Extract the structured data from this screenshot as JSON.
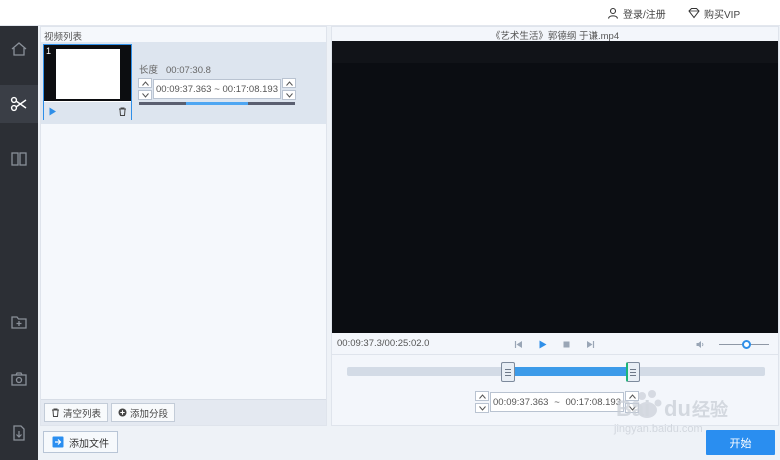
{
  "topbar": {
    "login_label": "登录/注册",
    "vip_label": "购买VIP",
    "login_icon": "user-icon",
    "vip_icon": "diamond-icon"
  },
  "sidebar": {
    "items": [
      {
        "name": "home",
        "icon": "home-icon"
      },
      {
        "name": "cut",
        "icon": "scissors-icon",
        "active": true
      },
      {
        "name": "split",
        "icon": "split-icon"
      },
      {
        "name": "add-folder",
        "icon": "folder-add-icon"
      },
      {
        "name": "screenshot",
        "icon": "camera-icon"
      },
      {
        "name": "export",
        "icon": "export-icon"
      }
    ]
  },
  "video_list": {
    "title": "视频列表",
    "items": [
      {
        "index": "1",
        "length_label": "长度",
        "length_value": "00:07:30.8",
        "range_start": "00:09:37.363",
        "range_sep": "~",
        "range_end": "00:17:08.193",
        "segment_fraction": 0.4
      }
    ],
    "clear_label": "清空列表",
    "add_segment_label": "添加分段"
  },
  "player": {
    "title": "《艺术生活》郭德纲 于谦.mp4",
    "time_display": "00:09:37.3/00:25:02.0",
    "volume_level": 0.55
  },
  "trim": {
    "start": "00:09:37.363",
    "sep": "~",
    "end": "00:17:08.193",
    "start_fraction": 0.384,
    "end_fraction": 0.684
  },
  "footer": {
    "add_file_label": "添加文件",
    "start_label": "开始"
  },
  "colors": {
    "accent": "#2a8ef0",
    "sidebar_bg": "#2c2f35",
    "player_bg": "#0b0d12",
    "handle_green": "#1db57a"
  }
}
